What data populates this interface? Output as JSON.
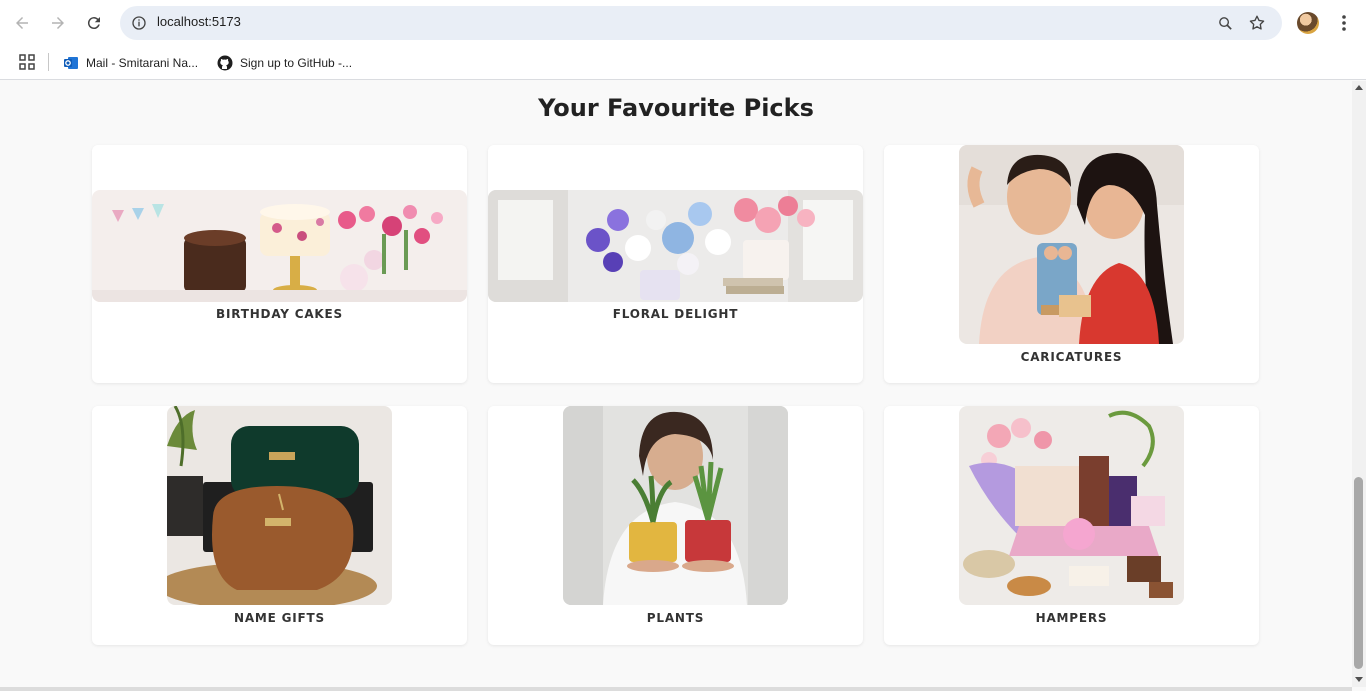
{
  "browser": {
    "url": "localhost:5173",
    "bookmarks": [
      {
        "label": "Mail - Smitarani Na...",
        "icon": "outlook-icon"
      },
      {
        "label": "Sign up to GitHub -...",
        "icon": "github-icon"
      }
    ]
  },
  "page": {
    "section_title": "Your Favourite Picks",
    "categories": [
      {
        "label": "BIRTHDAY CAKES",
        "image": "birthday-cakes-image"
      },
      {
        "label": "FLORAL DELIGHT",
        "image": "floral-delight-image"
      },
      {
        "label": "CARICATURES",
        "image": "caricatures-image"
      },
      {
        "label": "NAME GIFTS",
        "image": "name-gifts-image"
      },
      {
        "label": "PLANTS",
        "image": "plants-image"
      },
      {
        "label": "HAMPERS",
        "image": "hampers-image"
      }
    ]
  },
  "colors": {
    "page_background": "#f9f9f9",
    "card_background": "#ffffff",
    "omnibox": "#e9eef6",
    "title_text": "#222222"
  }
}
